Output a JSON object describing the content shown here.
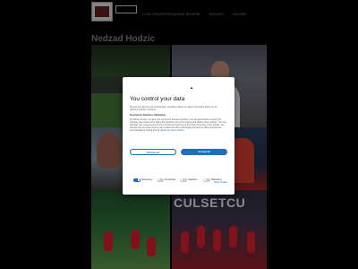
{
  "header": {
    "nav": [
      "CLUB-TRANSFERTRAINING",
      "BEWERB",
      "KONTAKT",
      "GALERIE"
    ]
  },
  "page": {
    "title": "Nedzad Hodzic",
    "banner_text": "CULSETCU"
  },
  "consent": {
    "logo_glyph": "▲",
    "title": "You control your data",
    "description": "We and our partners use technologies, including cookies, to collect information about you for various purposes, including:",
    "purposes_heading": "Functional, Statistics, Marketing",
    "body_text": "By clicking 'Accept', you give your consent for all these purposes. You can also choose to specify the purposes you consent to by ticking the checkbox next to the purpose and clicking 'Save settings'. You may withdraw your consent at any time by clicking the small icon at the bottom left corner of the website. You can find out more about how we use cookies and other technologies and how we collect and process personal data by clicking the link.",
    "read_more_link": "Read more about cookies",
    "decline_label": "Decline all",
    "accept_label": "Accept all",
    "toggles": [
      {
        "label": "Necessary",
        "on": true
      },
      {
        "label": "Functional",
        "on": false
      },
      {
        "label": "Statistics",
        "on": false
      },
      {
        "label": "Marketing",
        "on": false
      }
    ],
    "show_details_label": "Show details"
  },
  "colors": {
    "accent": "#1d6fbd",
    "background": "#000000"
  }
}
